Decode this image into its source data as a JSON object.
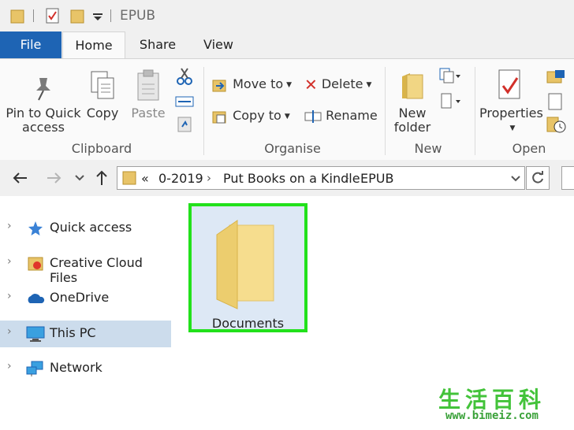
{
  "window": {
    "title": "EPUB"
  },
  "tabs": [
    "File",
    "Home",
    "Share",
    "View"
  ],
  "ribbon": {
    "clipboard": {
      "label": "Clipboard",
      "pin_label": "Pin to Quick access",
      "copy_label": "Copy",
      "paste_label": "Paste"
    },
    "organise": {
      "label": "Organise",
      "move_to": "Move to",
      "copy_to": "Copy to",
      "delete": "Delete",
      "rename": "Rename"
    },
    "new": {
      "label": "New",
      "new_folder": "New folder"
    },
    "open": {
      "label": "Open",
      "properties": "Properties"
    }
  },
  "address": {
    "overflow": "«",
    "crumbs": [
      "0-2019",
      "Put Books on a Kindle",
      "EPUB"
    ]
  },
  "nav": {
    "items": [
      {
        "label": "Quick access"
      },
      {
        "label": "Creative Cloud Files"
      },
      {
        "label": "OneDrive"
      },
      {
        "label": "This PC"
      },
      {
        "label": "Network"
      }
    ]
  },
  "content": {
    "items": [
      {
        "label": "Documents"
      }
    ]
  },
  "watermark": {
    "text": "生活百科",
    "url": "www.bimeiz.com"
  },
  "colors": {
    "file_tab": "#1e64b4",
    "selection": "#ccdcec",
    "highlight_border": "#22e11b"
  }
}
